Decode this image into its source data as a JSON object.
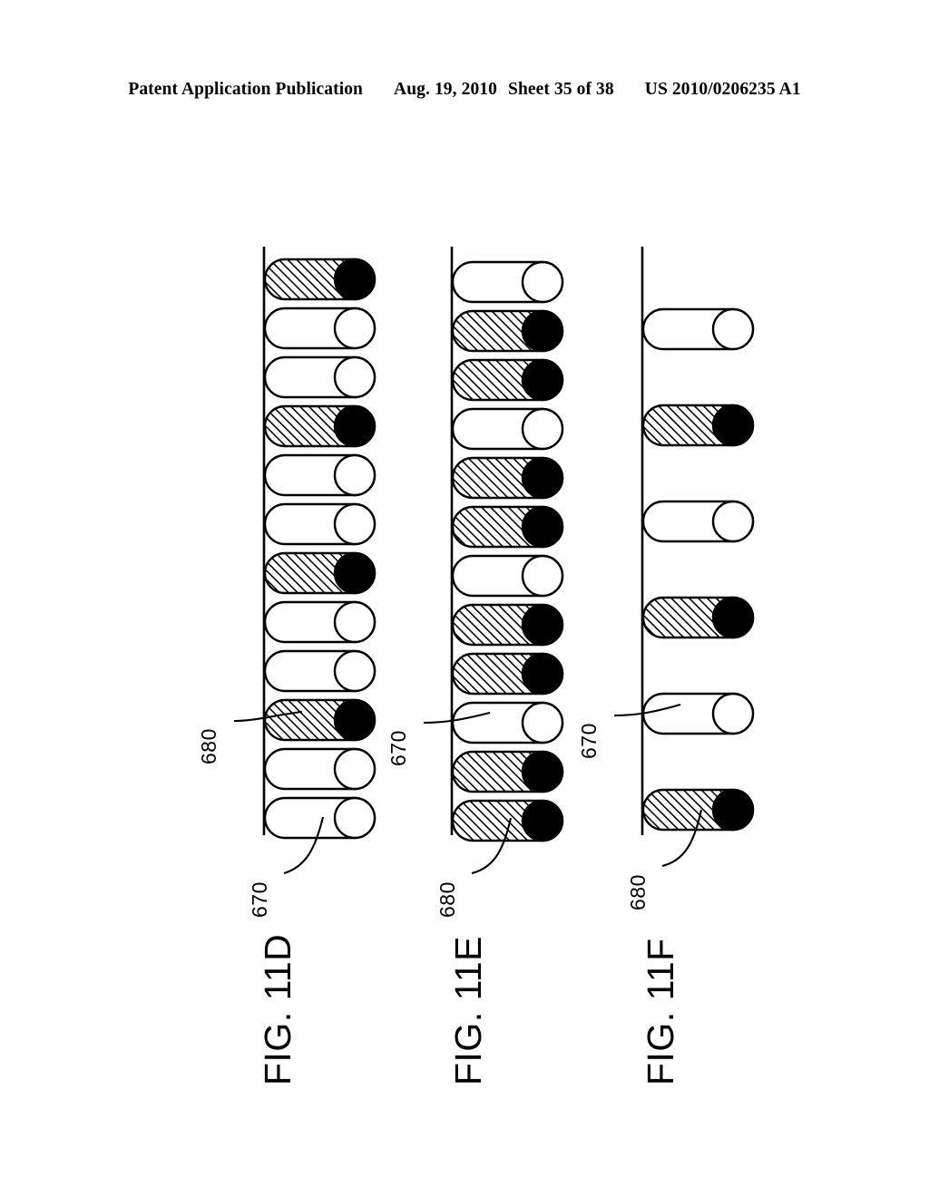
{
  "header": {
    "publication": "Patent Application Publication",
    "date": "Aug. 19, 2010",
    "sheet": "Sheet 35 of 38",
    "patent_number": "US 2010/0206235 A1"
  },
  "colors": {
    "ink": "#000000",
    "page": "#ffffff",
    "hatch_fill": "#000000",
    "open_fill": "#ffffff"
  },
  "legend": {
    "hatched_ref": "680",
    "open_ref": "670",
    "hatched_description": "hatched cylinder with solid black end cap",
    "open_description": "open (unfilled) cylinder with white end cap"
  },
  "figures": [
    {
      "id": "fig-11d",
      "caption": "FIG. 11D",
      "cylinder_count": 12,
      "pattern": "hatched, open, open (repeated 4 times)",
      "cylinders": [
        "hatched",
        "open",
        "open",
        "hatched",
        "open",
        "open",
        "hatched",
        "open",
        "open",
        "hatched",
        "open",
        "open"
      ],
      "callouts": [
        {
          "label": "680",
          "target_index": 9,
          "target_type": "hatched"
        },
        {
          "label": "670",
          "target_index": 11,
          "target_type": "open"
        }
      ]
    },
    {
      "id": "fig-11e",
      "caption": "FIG. 11E",
      "cylinder_count": 12,
      "pattern": "open, hatched, hatched (repeated 4 times)",
      "cylinders": [
        "open",
        "hatched",
        "hatched",
        "open",
        "hatched",
        "hatched",
        "open",
        "hatched",
        "hatched",
        "open",
        "hatched",
        "hatched"
      ],
      "callouts": [
        {
          "label": "670",
          "target_index": 9,
          "target_type": "open"
        },
        {
          "label": "680",
          "target_index": 11,
          "target_type": "hatched"
        }
      ]
    },
    {
      "id": "fig-11f",
      "caption": "FIG. 11F",
      "cylinder_count": 6,
      "pattern": "open, hatched (repeated 3 times, double spacing)",
      "cylinders": [
        "open",
        "hatched",
        "open",
        "hatched",
        "open",
        "hatched"
      ],
      "callouts": [
        {
          "label": "670",
          "target_index": 4,
          "target_type": "open"
        },
        {
          "label": "680",
          "target_index": 5,
          "target_type": "hatched"
        }
      ]
    }
  ]
}
